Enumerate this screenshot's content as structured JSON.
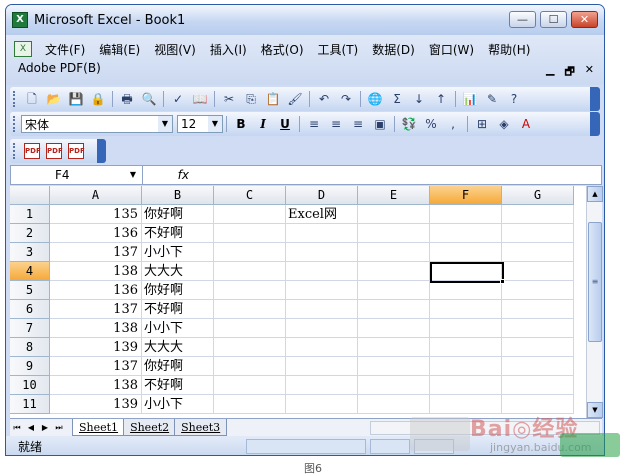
{
  "window": {
    "title": "Microsoft Excel - Book1",
    "app_icon_label": "X"
  },
  "window_controls": {
    "minimize": "—",
    "maximize": "☐",
    "close": "✕"
  },
  "menu": {
    "items": [
      "文件(F)",
      "编辑(E)",
      "视图(V)",
      "插入(I)",
      "格式(O)",
      "工具(T)",
      "数据(D)",
      "窗口(W)",
      "帮助(H)"
    ],
    "second_row": "Adobe PDF(B)",
    "doc_controls": [
      "▁",
      "🗗",
      "✕"
    ]
  },
  "formatting": {
    "font_name": "宋体",
    "font_size": "12"
  },
  "formula_bar": {
    "name_box": "F4",
    "fx_label": "fx",
    "content": ""
  },
  "grid": {
    "columns": [
      "A",
      "B",
      "C",
      "D",
      "E",
      "F",
      "G"
    ],
    "selected_column": "F",
    "selected_row": "4",
    "rows": [
      {
        "n": "1",
        "a": "135",
        "b": "你好啊",
        "d": "Excel网"
      },
      {
        "n": "2",
        "a": "136",
        "b": "不好啊",
        "d": ""
      },
      {
        "n": "3",
        "a": "137",
        "b": "小小下",
        "d": ""
      },
      {
        "n": "4",
        "a": "138",
        "b": "大大大",
        "d": ""
      },
      {
        "n": "5",
        "a": "136",
        "b": "你好啊",
        "d": ""
      },
      {
        "n": "6",
        "a": "137",
        "b": "不好啊",
        "d": ""
      },
      {
        "n": "7",
        "a": "138",
        "b": "小小下",
        "d": ""
      },
      {
        "n": "8",
        "a": "139",
        "b": "大大大",
        "d": ""
      },
      {
        "n": "9",
        "a": "137",
        "b": "你好啊",
        "d": ""
      },
      {
        "n": "10",
        "a": "138",
        "b": "不好啊",
        "d": ""
      },
      {
        "n": "11",
        "a": "139",
        "b": "小小下",
        "d": ""
      }
    ]
  },
  "sheets": [
    "Sheet1",
    "Sheet2",
    "Sheet3"
  ],
  "active_sheet": "Sheet1",
  "status": {
    "text": "就绪"
  },
  "watermark": {
    "main": "Bai◎经验",
    "sub": "jingyan.baidu.com"
  },
  "caption": "图6",
  "colors": {
    "selected_header": "#f6a939",
    "title_gradient_end": "#b8cdee",
    "grid_line": "#d0d7e5"
  }
}
